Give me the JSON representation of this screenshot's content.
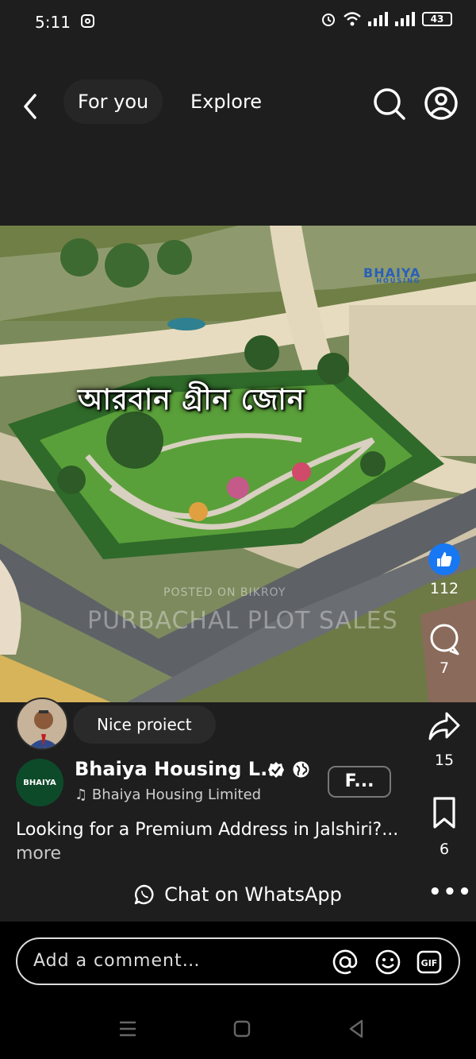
{
  "status_bar": {
    "time": "5:11",
    "battery": "43"
  },
  "header": {
    "tabs": [
      {
        "label": "For you"
      },
      {
        "label": "Explore"
      }
    ]
  },
  "video": {
    "overlay_title": "আরবান গ্রীন জোন",
    "logo_text": "BHAIYA",
    "logo_sub": "HOUSING",
    "watermark_posted": "POSTED ON BIKROY",
    "watermark_sale": "PURBACHAL PLOT SALES"
  },
  "actions": {
    "likes": "112",
    "comments": "7",
    "shares": "15",
    "saves": "6"
  },
  "top_comment": {
    "text": "Nice proiect"
  },
  "post": {
    "page_name": "Bhaiya Housing L...",
    "avatar_text": "BHAIYA",
    "music": "Bhaiya Housing Limited",
    "follow_label": "F...",
    "caption": "Looking for a Premium Address in Jalshiri?...",
    "more_label": "more",
    "cta_label": "Chat on WhatsApp"
  },
  "comment_box": {
    "placeholder": "Add a comment…"
  }
}
